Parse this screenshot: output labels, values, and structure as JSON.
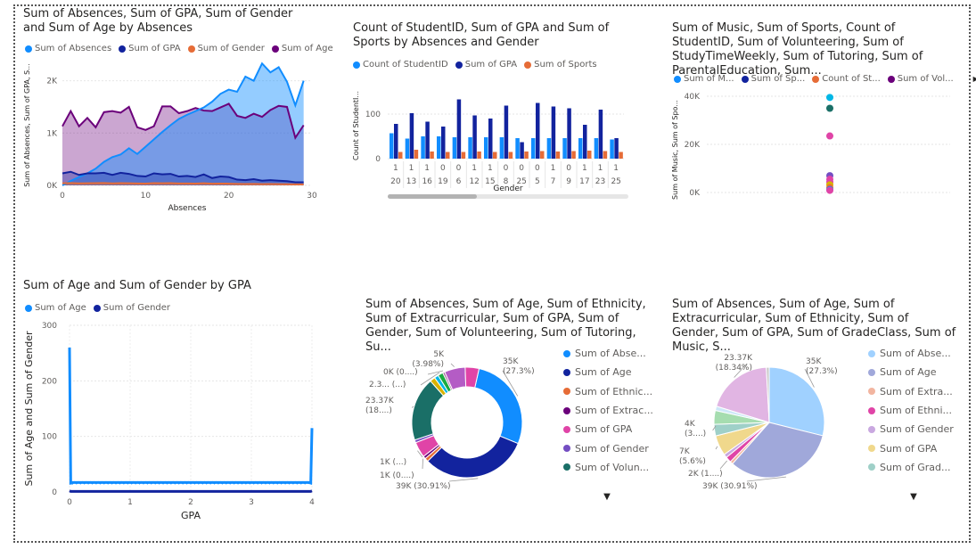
{
  "colors": {
    "blue": "#118DFF",
    "navy": "#12239E",
    "orange": "#E66C37",
    "purple": "#6B007B",
    "pink": "#E044A7",
    "teal": "#1A6F67",
    "gray": "#A6A6A6",
    "gold": "#D9B300",
    "violet": "#744EC2",
    "cyan": "#00B7E6"
  },
  "chart_data": [
    {
      "type": "area",
      "title": "Sum of Absences, Sum of GPA, Sum of Gender and Sum of Age by Absences",
      "xlabel": "Absences",
      "ylabel": "Sum of Absences, Sum of GPA, S...",
      "xticks": [
        "0",
        "10",
        "20",
        "30"
      ],
      "yticks": [
        "0K",
        "1K",
        "2K"
      ],
      "xlim": [
        0,
        30
      ],
      "ylim": [
        0,
        2300
      ],
      "series": [
        {
          "name": "Sum of Absences",
          "color": "#118DFF",
          "x": [
            0,
            1,
            2,
            3,
            4,
            5,
            6,
            7,
            8,
            9,
            10,
            11,
            12,
            13,
            14,
            15,
            16,
            17,
            18,
            19,
            20,
            21,
            22,
            23,
            24,
            25,
            26,
            27,
            28,
            29
          ],
          "values": [
            0,
            85,
            160,
            230,
            320,
            450,
            540,
            590,
            710,
            600,
            740,
            880,
            1020,
            1150,
            1270,
            1350,
            1420,
            1490,
            1600,
            1750,
            1830,
            1790,
            2080,
            2000,
            2330,
            2160,
            2260,
            1980,
            1530,
            2000
          ]
        },
        {
          "name": "Sum of GPA",
          "color": "#12239E",
          "x": [
            0,
            1,
            2,
            3,
            4,
            5,
            6,
            7,
            8,
            9,
            10,
            11,
            12,
            13,
            14,
            15,
            16,
            17,
            18,
            19,
            20,
            21,
            22,
            23,
            24,
            25,
            26,
            27,
            28,
            29
          ],
          "values": [
            230,
            260,
            200,
            230,
            230,
            240,
            200,
            240,
            220,
            180,
            170,
            230,
            210,
            220,
            170,
            180,
            160,
            210,
            140,
            170,
            160,
            110,
            100,
            120,
            90,
            100,
            90,
            80,
            60,
            60
          ]
        },
        {
          "name": "Sum of Gender",
          "color": "#E66C37",
          "x": [
            0,
            1,
            2,
            3,
            4,
            5,
            6,
            7,
            8,
            9,
            10,
            11,
            12,
            13,
            14,
            15,
            16,
            17,
            18,
            19,
            20,
            21,
            22,
            23,
            24,
            25,
            26,
            27,
            28,
            29
          ],
          "values": [
            40,
            45,
            38,
            40,
            42,
            44,
            38,
            42,
            40,
            36,
            34,
            42,
            40,
            42,
            36,
            36,
            34,
            40,
            32,
            34,
            33,
            28,
            26,
            28,
            24,
            25,
            24,
            22,
            20,
            20
          ]
        },
        {
          "name": "Sum of Age",
          "color": "#6B007B",
          "x": [
            0,
            1,
            2,
            3,
            4,
            5,
            6,
            7,
            8,
            9,
            10,
            11,
            12,
            13,
            14,
            15,
            16,
            17,
            18,
            19,
            20,
            21,
            22,
            23,
            24,
            25,
            26,
            27,
            28,
            29
          ],
          "values": [
            1130,
            1420,
            1130,
            1290,
            1110,
            1400,
            1420,
            1390,
            1500,
            1110,
            1060,
            1130,
            1510,
            1510,
            1380,
            1420,
            1480,
            1430,
            1420,
            1490,
            1560,
            1330,
            1290,
            1370,
            1310,
            1440,
            1520,
            1500,
            910,
            1150
          ]
        }
      ]
    },
    {
      "type": "bar",
      "title": "Count of StudentID, Sum of GPA and Sum of Sports by Absences and Gender",
      "xlabel": "Gender",
      "ylabel": "Count of StudentI...",
      "yticks": [
        "0",
        "100"
      ],
      "ylim": [
        0,
        150
      ],
      "categories_top": [
        "1",
        "1",
        "1",
        "0",
        "0",
        "1",
        "1",
        "0",
        "0",
        "0",
        "1",
        "0",
        "1",
        "1",
        "1"
      ],
      "categories": [
        "20",
        "13",
        "16",
        "19",
        "6",
        "12",
        "15",
        "8",
        "25",
        "5",
        "7",
        "9",
        "17",
        "23",
        "25"
      ],
      "series": [
        {
          "name": "Count of StudentID",
          "color": "#118DFF",
          "values": [
            57,
            45,
            50,
            50,
            48,
            48,
            48,
            48,
            46,
            46,
            46,
            46,
            46,
            46,
            43
          ]
        },
        {
          "name": "Sum of GPA",
          "color": "#12239E",
          "values": [
            78,
            102,
            83,
            72,
            133,
            97,
            90,
            119,
            37,
            125,
            117,
            113,
            76,
            110,
            46
          ]
        },
        {
          "name": "Sum of Sports",
          "color": "#E66C37",
          "values": [
            15,
            20,
            16,
            15,
            15,
            16,
            15,
            15,
            16,
            17,
            16,
            17,
            18,
            17,
            15
          ]
        }
      ]
    },
    {
      "type": "scatter",
      "title": "Sum of Music, Sum of Sports, Count of StudentID, Sum of Volunteering, Sum of StudyTimeWeekly, Sum of Tutoring, Sum of ParentalEducation, Sum...",
      "ylabel": "Sum of Music, Sum of Spo...",
      "yticks": [
        "0K",
        "20K",
        "40K"
      ],
      "ylim": [
        0,
        40000
      ],
      "legend": [
        "Sum of M...",
        "Sum of Sp...",
        "Count of St...",
        "Sum of Vol..."
      ],
      "points": [
        {
          "value": 39500,
          "color": "#00B7E6"
        },
        {
          "value": 35000,
          "color": "#1A6F67"
        },
        {
          "value": 23500,
          "color": "#E044A7"
        },
        {
          "value": 7000,
          "color": "#744EC2"
        },
        {
          "value": 5500,
          "color": "#E044A7"
        },
        {
          "value": 4300,
          "color": "#E044A7"
        },
        {
          "value": 3200,
          "color": "#D9B300"
        },
        {
          "value": 2000,
          "color": "#E66C37"
        },
        {
          "value": 1200,
          "color": "#118DFF"
        },
        {
          "value": 900,
          "color": "#E044A7"
        }
      ]
    },
    {
      "type": "line",
      "title": "Sum of Age and Sum of Gender by GPA",
      "xlabel": "GPA",
      "ylabel": "Sum of Age and Sum of Gender",
      "xticks": [
        "0",
        "1",
        "2",
        "3",
        "4"
      ],
      "yticks": [
        "0",
        "100",
        "200",
        "300"
      ],
      "xlim": [
        0,
        4
      ],
      "ylim": [
        0,
        300
      ],
      "series": [
        {
          "name": "Sum of Age",
          "color": "#118DFF",
          "x": [
            0,
            0.02,
            0.05,
            3.95,
            3.98,
            4
          ],
          "values": [
            260,
            16,
            17,
            17,
            16,
            115
          ]
        },
        {
          "name": "Sum of Gender",
          "color": "#12239E",
          "x": [
            0,
            0.02,
            3.98,
            4
          ],
          "values": [
            2,
            1,
            1,
            2
          ]
        }
      ]
    },
    {
      "type": "pie",
      "title": "Sum of Absences, Sum of Age, Sum of Ethnicity, Sum of Extracurricular, Sum of GPA, Sum of Gender, Sum of Volunteering, Sum of Tutoring, Su...",
      "legend": [
        "Sum of Abse...",
        "Sum of Age",
        "Sum of Ethnic...",
        "Sum of Extrac...",
        "Sum of GPA",
        "Sum of Gender",
        "Sum of Volun..."
      ],
      "slices": [
        {
          "label": "35K\n(27.3%)",
          "value": 27.3,
          "color": "#118DFF"
        },
        {
          "label": "39K (30.91%)",
          "value": 30.91,
          "color": "#12239E"
        },
        {
          "label": "",
          "value": 1.0,
          "color": "#E66C37"
        },
        {
          "label": "1K (0....)",
          "value": 0.8,
          "color": "#6B007B"
        },
        {
          "label": "1K (...)",
          "value": 4.5,
          "color": "#E044A7"
        },
        {
          "label": "",
          "value": 0.8,
          "color": "#744EC2"
        },
        {
          "label": "23.37K\n(18....)",
          "value": 18.34,
          "color": "#1A6F67"
        },
        {
          "label": "",
          "value": 1.5,
          "color": "#D9B300"
        },
        {
          "label": "",
          "value": 1.2,
          "color": "#00B7E6"
        },
        {
          "label": "2.3... (...)",
          "value": 1.5,
          "color": "#1AAB40"
        },
        {
          "label": "0K (0....)",
          "value": 0.6,
          "color": "#A66999"
        },
        {
          "label": "5K\n(3.98%)",
          "value": 6.0,
          "color": "#B45CC5"
        },
        {
          "label": "",
          "value": 3.98,
          "color": "#E044A7"
        }
      ]
    },
    {
      "type": "pie",
      "title": "Sum of Absences, Sum of Age, Sum of Extracurricular, Sum of Ethnicity, Sum of Gender, Sum of GPA, Sum of GradeClass, Sum of Music, S...",
      "legend": [
        "Sum of Abse...",
        "Sum of Age",
        "Sum of Extra...",
        "Sum of Ethni...",
        "Sum of Gender",
        "Sum of GPA",
        "Sum of Grad..."
      ],
      "slices": [
        {
          "label": "35K\n(27.3%)",
          "value": 27.3,
          "color": "#A0D1FF"
        },
        {
          "label": "39K (30.91%)",
          "value": 30.91,
          "color": "#A0A8DA"
        },
        {
          "label": "",
          "value": 0.8,
          "color": "#F2B5A0"
        },
        {
          "label": "2K (1....)",
          "value": 1.6,
          "color": "#E044A7"
        },
        {
          "label": "",
          "value": 1.0,
          "color": "#C9A8E0"
        },
        {
          "label": "7K\n(5.6%)",
          "value": 5.6,
          "color": "#F0D88C"
        },
        {
          "label": "4K\n(3....)",
          "value": 3.2,
          "color": "#9FD0C8"
        },
        {
          "label": "",
          "value": 3.8,
          "color": "#A6DDB0"
        },
        {
          "label": "",
          "value": 1.2,
          "color": "#CDE8F8"
        },
        {
          "label": "23.37K\n(18.34%)",
          "value": 18.34,
          "color": "#E1B5E3"
        },
        {
          "label": "",
          "value": 0.8,
          "color": "#C8C8C8"
        }
      ]
    }
  ]
}
